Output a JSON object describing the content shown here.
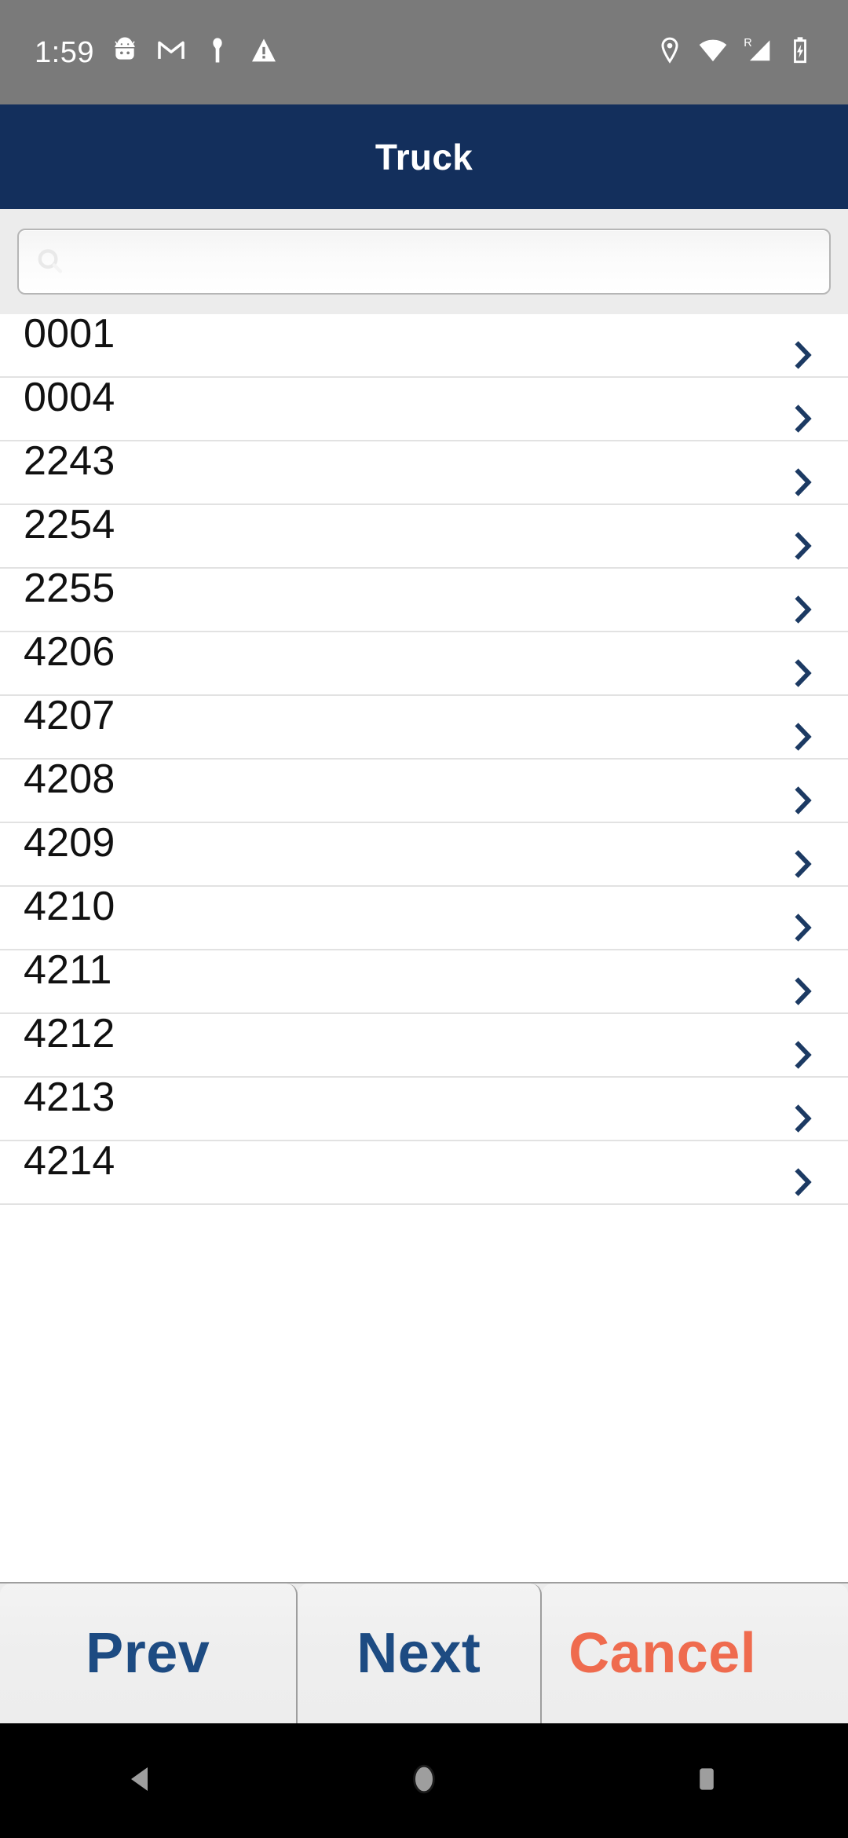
{
  "status_bar": {
    "time": "1:59",
    "left_icons": [
      "android-debug-icon",
      "gmail-icon",
      "person-icon",
      "warning-icon"
    ],
    "right_icons": [
      "location-pin-icon",
      "wifi-icon",
      "roaming-signal-icon",
      "battery-charging-icon"
    ],
    "roaming_label": "R",
    "background": "#7a7a7a"
  },
  "app_bar": {
    "title": "Truck",
    "background": "#132f5c"
  },
  "search": {
    "value": "",
    "placeholder": "",
    "icon": "search-icon"
  },
  "list": {
    "row_chevron_icon": "chevron-right-icon",
    "chevron_color": "#1c3a63",
    "rows": [
      {
        "label": "0001"
      },
      {
        "label": "0004"
      },
      {
        "label": "2243"
      },
      {
        "label": "2254"
      },
      {
        "label": "2255"
      },
      {
        "label": "4206"
      },
      {
        "label": "4207"
      },
      {
        "label": "4208"
      },
      {
        "label": "4209"
      },
      {
        "label": "4210"
      },
      {
        "label": "4211"
      },
      {
        "label": "4212"
      },
      {
        "label": "4213"
      },
      {
        "label": "4214"
      }
    ]
  },
  "buttons": {
    "prev": "Prev",
    "next": "Next",
    "cancel": "Cancel",
    "primary_color": "#1d4b82",
    "cancel_color": "#ef6b4e"
  },
  "nav_bar": {
    "back": "back-triangle-icon",
    "home": "home-circle-icon",
    "recents": "recents-square-icon"
  }
}
